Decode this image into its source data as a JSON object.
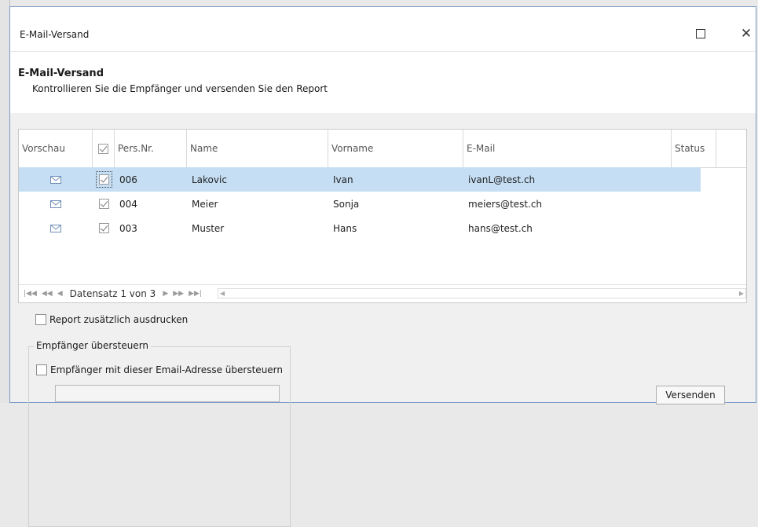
{
  "window": {
    "title": "E-Mail-Versand"
  },
  "header": {
    "title": "E-Mail-Versand",
    "subtitle": "Kontrollieren Sie die Empfänger und versenden Sie den Report"
  },
  "grid": {
    "columns": [
      "Vorschau",
      "",
      "Pers.Nr.",
      "Name",
      "Vorname",
      "E-Mail",
      "Status"
    ],
    "rows": [
      {
        "selected": true,
        "checked": true,
        "persnr": "006",
        "name": "Lakovic",
        "vorname": "Ivan",
        "email": "ivanL@test.ch",
        "status": ""
      },
      {
        "selected": false,
        "checked": true,
        "persnr": "004",
        "name": "Meier",
        "vorname": "Sonja",
        "email": "meiers@test.ch",
        "status": ""
      },
      {
        "selected": false,
        "checked": true,
        "persnr": "003",
        "name": "Muster",
        "vorname": "Hans",
        "email": "hans@test.ch",
        "status": ""
      }
    ],
    "navigator": {
      "text": "Datensatz 1 von 3"
    }
  },
  "options": {
    "print_label": "Report zusätzlich ausdrucken",
    "group_label": "Empfänger übersteuern",
    "override_label": "Empfänger mit dieser Email-Adresse übersteuern",
    "override_value": ""
  },
  "buttons": {
    "send": "Versenden"
  },
  "colors": {
    "selected_row": "#c5def3",
    "window_border": "#7a9cc6",
    "mail_icon": "#6f8fb8"
  }
}
